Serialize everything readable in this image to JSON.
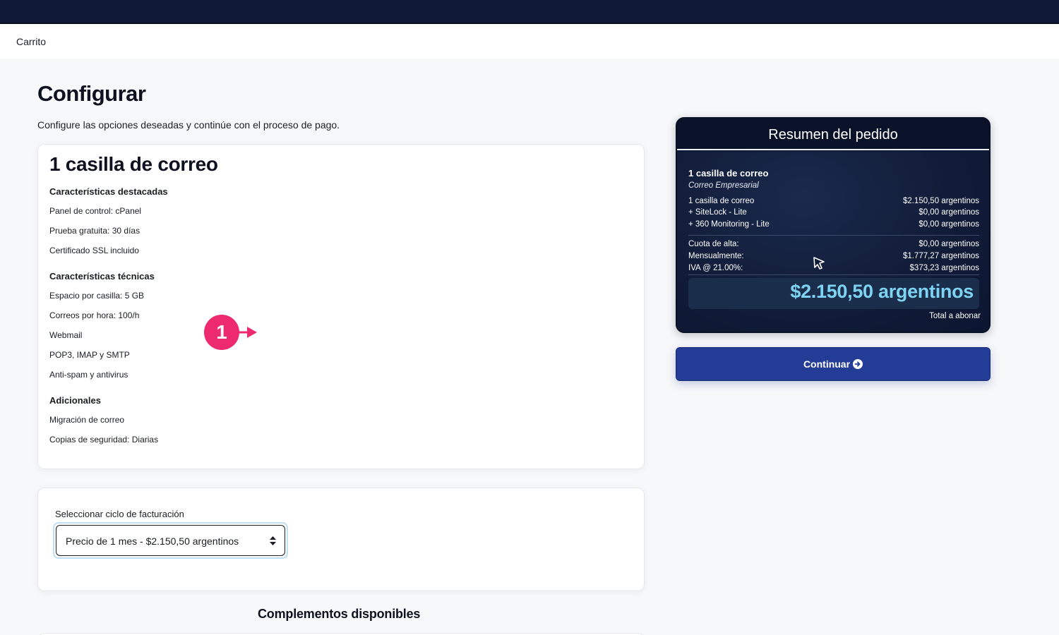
{
  "breadcrumb": "Carrito",
  "page": {
    "title": "Configurar",
    "subtitle": "Configure las opciones deseadas y continúe con el proceso de pago."
  },
  "product": {
    "name": "1 casilla de correo",
    "sections": [
      {
        "heading": "Características destacadas",
        "items": [
          "Panel de control: cPanel",
          "Prueba gratuita: 30 días",
          "Certificado SSL incluido"
        ]
      },
      {
        "heading": "Características técnicas",
        "items": [
          "Espacio por casilla: 5 GB",
          "Correos por hora: 100/h",
          "Webmail",
          "POP3, IMAP y SMTP",
          "Anti-spam y antivirus"
        ]
      },
      {
        "heading": "Adicionales",
        "items": [
          "Migración de correo",
          "Copias de seguridad: Diarias"
        ]
      }
    ],
    "badge": "1"
  },
  "billing": {
    "label": "Seleccionar ciclo de facturación",
    "selected": "Precio de 1 mes - $2.150,50 argentinos"
  },
  "addons": {
    "heading": "Complementos disponibles"
  },
  "summary": {
    "title": "Resumen del pedido",
    "product": "1 casilla de correo",
    "group": "Correo Empresarial",
    "items": [
      {
        "label": "1 casilla de correo",
        "value": "$2.150,50 argentinos"
      },
      {
        "label": "+ SiteLock - Lite",
        "value": "$0,00 argentinos"
      },
      {
        "label": "+ 360 Monitoring - Lite",
        "value": "$0,00 argentinos"
      }
    ],
    "fees": [
      {
        "label": "Cuota de alta:",
        "value": "$0,00 argentinos"
      },
      {
        "label": "Mensualmente:",
        "value": "$1.777,27 argentinos"
      },
      {
        "label": "IVA @ 21.00%:",
        "value": "$373,23 argentinos"
      }
    ],
    "total": "$2.150,50 argentinos",
    "total_label": "Total a abonar"
  },
  "continue_label": "Continuar",
  "colors": {
    "navy": "#101a36",
    "accent_blue": "#233c95",
    "total_cyan": "#7ed3f3",
    "badge_pink": "#ee2a6e"
  },
  "icons": {
    "continue": "arrow-circle-right-icon",
    "select": "select-arrows-icon",
    "cursor": "mouse-cursor-icon"
  }
}
